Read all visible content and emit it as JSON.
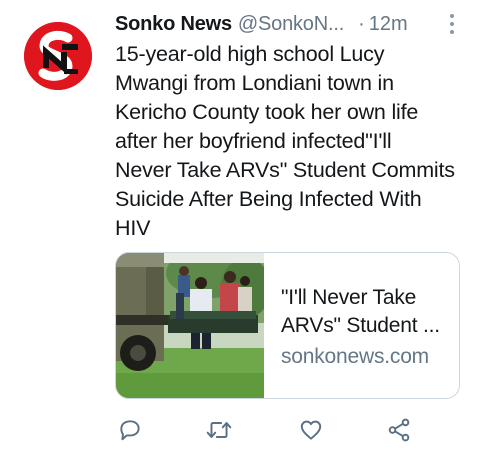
{
  "tweet": {
    "author_name": "Sonko News",
    "author_handle": "@SonkoN...",
    "separator": "·",
    "time": "12m",
    "avatar_text": "sonko news",
    "text_lines": [
      "15-year-old high school Lucy",
      "Mwangi from Londiani town in",
      "Kericho County took her own life",
      "after her boyfriend infected\"I'll",
      "Never Take ARVs\" Student Commits",
      "Suicide After Being Infected With",
      "HIV"
    ]
  },
  "card": {
    "title_lines": [
      "\"I'll Never Take",
      "ARVs\" Student ..."
    ],
    "domain": "sonkonews.com"
  },
  "actions": {
    "reply_icon": "reply-icon",
    "retweet_icon": "retweet-icon",
    "like_icon": "heart-icon",
    "share_icon": "share-icon"
  },
  "colors": {
    "primary_text": "#14171a",
    "secondary_text": "#657786",
    "border": "#ccd6dd",
    "brand_red": "#e0161f",
    "icon": "#5b7083"
  }
}
